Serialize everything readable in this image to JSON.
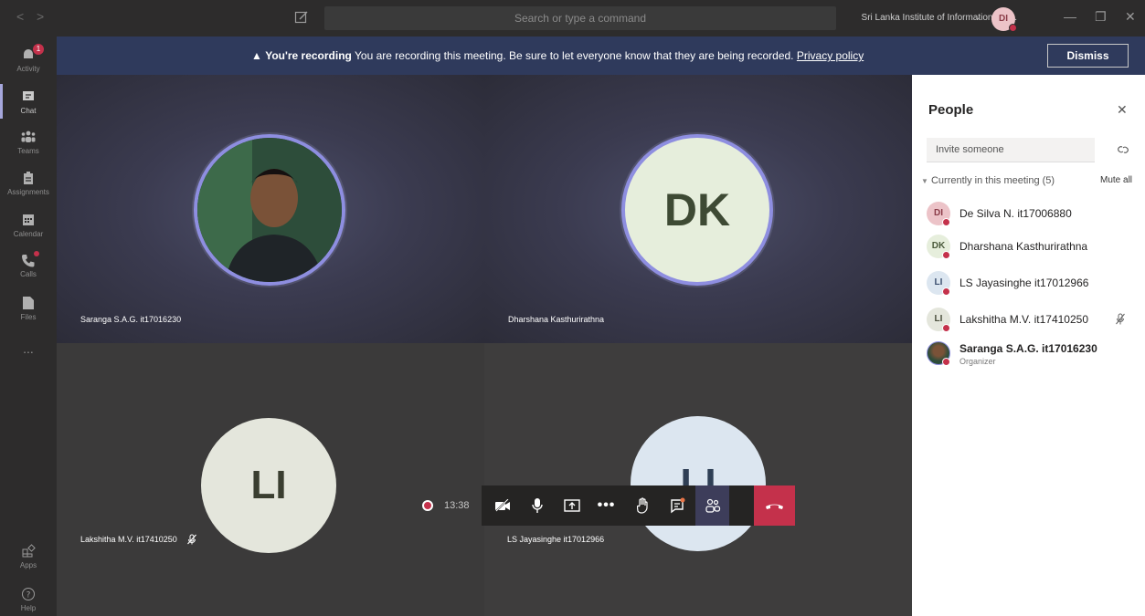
{
  "titlebar": {
    "back": "<",
    "forward": ">",
    "search_placeholder": "Search or type a command",
    "org": "Sri Lanka Institute of Information Tec...",
    "me_initials": "DI"
  },
  "rail": {
    "activity": {
      "label": "Activity",
      "badge": "1"
    },
    "chat": "Chat",
    "teams": "Teams",
    "assignments": "Assignments",
    "calendar": "Calendar",
    "calls": "Calls",
    "files": "Files",
    "more": "...",
    "apps": "Apps",
    "help": "Help"
  },
  "banner": {
    "title": "You're recording",
    "text": " You are recording this meeting. Be sure to let everyone know that they are being recorded. ",
    "link": "Privacy policy",
    "dismiss": "Dismiss"
  },
  "tiles": [
    {
      "name": "Saranga S.A.G. it17016230"
    },
    {
      "name": "Dharshana Kasthurirathna",
      "initials": "DK"
    },
    {
      "name": "Lakshitha M.V. it17410250",
      "initials": "LI"
    },
    {
      "name": "LS Jayasinghe it17012966",
      "initials": "LI"
    }
  ],
  "controls": {
    "timer": "13:38"
  },
  "people": {
    "title": "People",
    "invite_placeholder": "Invite someone",
    "section": "Currently in this meeting (5)",
    "mute_all": "Mute all",
    "list": [
      {
        "initials": "DI",
        "name": "De Silva N. it17006880",
        "color": "#ecc3c8",
        "fg": "#8a3c48"
      },
      {
        "initials": "DK",
        "name": "Dharshana Kasthurirathna",
        "color": "#e6eedc",
        "fg": "#4b5a3c"
      },
      {
        "initials": "LI",
        "name": "LS Jayasinghe it17012966",
        "color": "#dce6f0",
        "fg": "#3c5070"
      },
      {
        "initials": "LI",
        "name": "Lakshitha M.V. it17410250",
        "color": "#e4e6dc",
        "fg": "#4a4e3c"
      },
      {
        "initials": "",
        "name": "Saranga S.A.G. it17016230",
        "role": "Organizer"
      }
    ]
  }
}
